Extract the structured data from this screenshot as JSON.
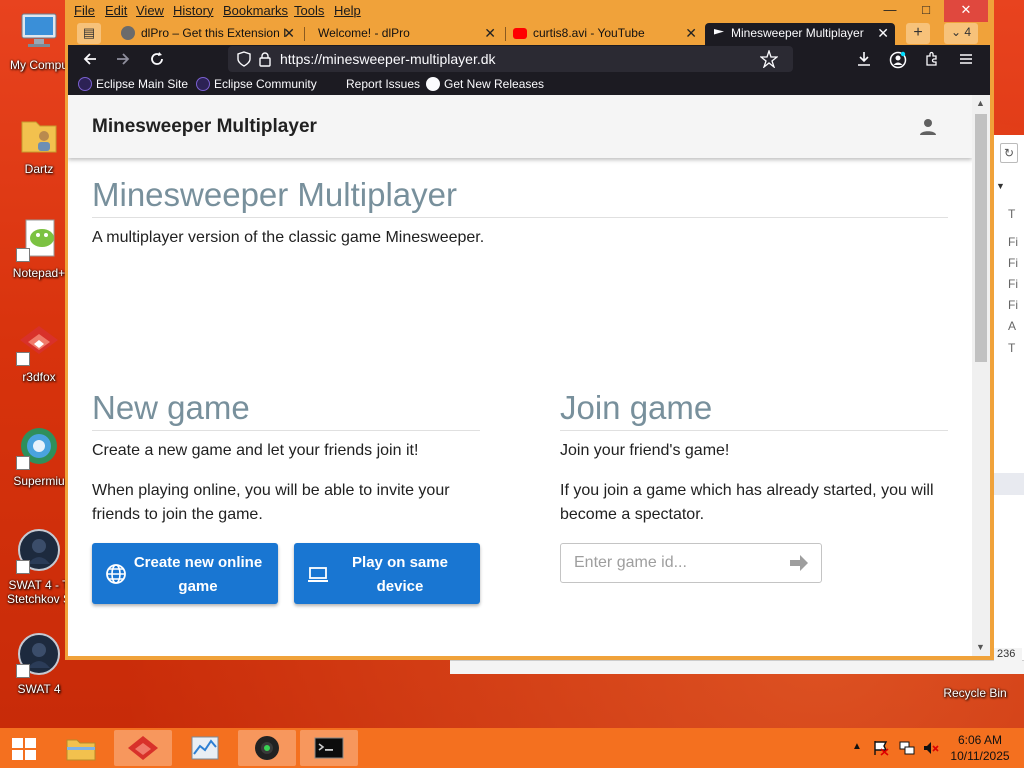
{
  "desktop": {
    "icons": [
      {
        "label": "My Compu",
        "icon": "computer-icon"
      },
      {
        "label": "Dartz",
        "icon": "folder-user-icon"
      },
      {
        "label": "Notepad+",
        "icon": "notepad-plus-icon"
      },
      {
        "label": "r3dfox",
        "icon": "r3dfox-icon"
      },
      {
        "label": "Supermiu",
        "icon": "supermium-icon"
      },
      {
        "label": "SWAT 4 - T\nStetchkov S",
        "icon": "swat4-icon"
      },
      {
        "label": "SWAT 4",
        "icon": "swat4-icon"
      },
      {
        "label": "Recycle Bin",
        "icon": "recycle-bin-icon"
      }
    ],
    "bg_window_rows": [
      "T",
      "Fi",
      "Fi",
      "Fi",
      "Fi",
      "A",
      "T"
    ],
    "bg_window_number": "236"
  },
  "browser": {
    "menu": [
      "File",
      "Edit",
      "View",
      "History",
      "Bookmarks",
      "Tools",
      "Help"
    ],
    "tabs": [
      {
        "title": "dlPro – Get this Extension I",
        "icon": "firefox-addon-icon"
      },
      {
        "title": "Welcome! - dlPro",
        "icon": "none"
      },
      {
        "title": "curtis8.avi - YouTube",
        "icon": "youtube-icon"
      },
      {
        "title": "Minesweeper Multiplayer",
        "icon": "flag-icon",
        "active": true
      }
    ],
    "tab_count": "4",
    "url": "https://minesweeper-multiplayer.dk",
    "bookmarks": [
      {
        "label": "Eclipse Main Site",
        "icon": "eclipse-icon"
      },
      {
        "label": "Eclipse Community",
        "icon": "eclipse-icon"
      },
      {
        "label": "Report Issues",
        "icon": "none"
      },
      {
        "label": "Get New Releases",
        "icon": "github-icon"
      }
    ]
  },
  "page": {
    "header_title": "Minesweeper Multiplayer",
    "title": "Minesweeper Multiplayer",
    "subtitle": "A multiplayer version of the classic game Minesweeper.",
    "new_game": {
      "heading": "New game",
      "text1": "Create a new game and let your friends join it!",
      "text2": "When playing online, you will be able to invite your friends to join the game.",
      "online_button": "Create new online game",
      "local_button": "Play on same device"
    },
    "join_game": {
      "heading": "Join game",
      "text1": "Join your friend's game!",
      "text2": "If you join a game which has already started, you will become a spectator.",
      "input_placeholder": "Enter game id..."
    },
    "accent_color": "#1976d2",
    "heading_color": "#78909c"
  },
  "taskbar": {
    "apps": [
      "file-explorer-icon",
      "r3dfox-icon",
      "task-manager-icon",
      "media-player-icon",
      "terminal-icon"
    ],
    "time": "6:06 AM",
    "date": "10/11/2025"
  }
}
